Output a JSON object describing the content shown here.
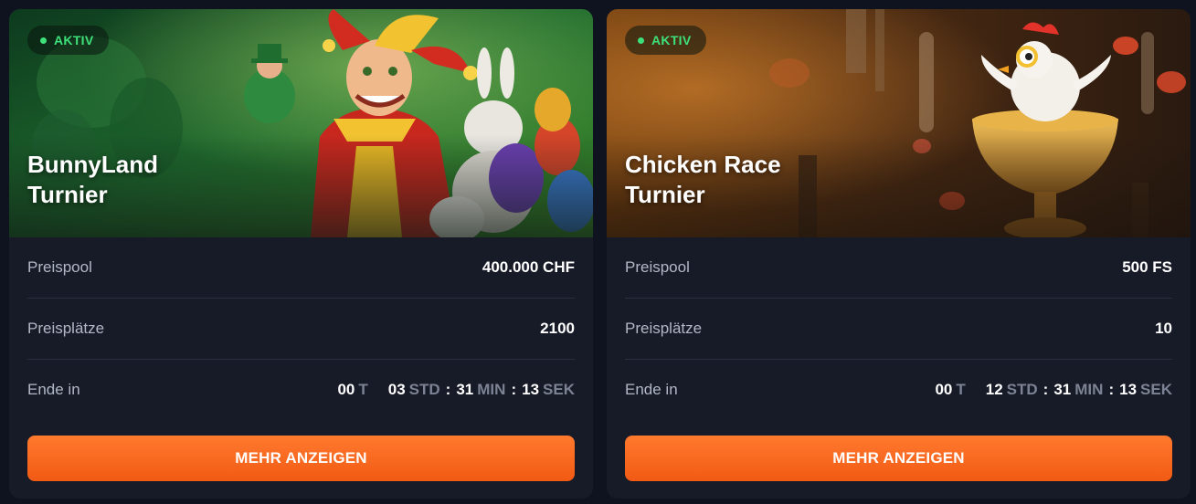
{
  "tournaments": [
    {
      "status": "AKTIV",
      "title_line1": "BunnyLand",
      "title_line2": "Turnier",
      "prize_pool_label": "Preispool",
      "prize_pool_value": "400.000 CHF",
      "prize_places_label": "Preisplätze",
      "prize_places_value": "2100",
      "ends_in_label": "Ende in",
      "timer": {
        "days": "00",
        "days_unit": "T",
        "hours": "03",
        "hours_unit": "STD",
        "minutes": "31",
        "minutes_unit": "MIN",
        "seconds": "13",
        "seconds_unit": "SEK"
      },
      "button_label": "MEHR ANZEIGEN"
    },
    {
      "status": "AKTIV",
      "title_line1": "Chicken Race",
      "title_line2": "Turnier",
      "prize_pool_label": "Preispool",
      "prize_pool_value": "500 FS",
      "prize_places_label": "Preisplätze",
      "prize_places_value": "10",
      "ends_in_label": "Ende in",
      "timer": {
        "days": "00",
        "days_unit": "T",
        "hours": "12",
        "hours_unit": "STD",
        "minutes": "31",
        "minutes_unit": "MIN",
        "seconds": "13",
        "seconds_unit": "SEK"
      },
      "button_label": "MEHR ANZEIGEN"
    }
  ],
  "colors": {
    "page_bg": "#0f1320",
    "card_bg": "#171b27",
    "active_green": "#3ee07a",
    "button_orange": "#f25a14",
    "label_gray": "#b3b8c6",
    "unit_gray": "#7d8394"
  }
}
